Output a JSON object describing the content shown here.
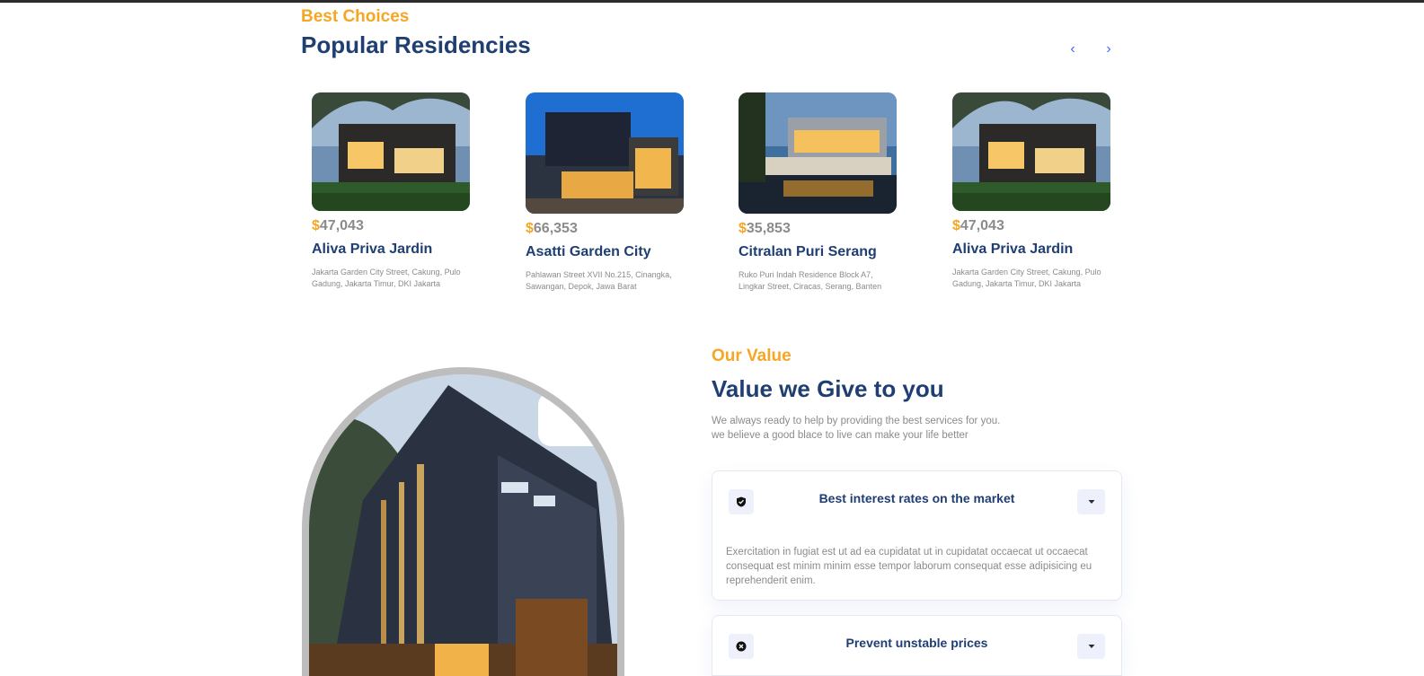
{
  "residencies": {
    "eyebrow": "Best Choices",
    "title": "Popular Residencies",
    "nav": {
      "prev_icon": "chevron-left-icon",
      "next_icon": "chevron-right-icon",
      "prev_glyph": "‹",
      "next_glyph": "›"
    },
    "cards": [
      {
        "currency": "$",
        "price": "47,043",
        "name": "Aliva Priva Jardin",
        "address": "Jakarta Garden City Street, Cakung, Pulo Gadung, Jakarta Timur, DKI Jakarta"
      },
      {
        "currency": "$",
        "price": "66,353",
        "name": "Asatti Garden City",
        "address": "Pahlawan Street XVII No.215, Cinangka, Sawangan, Depok, Jawa Barat"
      },
      {
        "currency": "$",
        "price": "35,853",
        "name": "Citralan Puri Serang",
        "address": "Ruko Puri Indah Residence Block A7, Lingkar Street, Ciracas, Serang, Banten"
      },
      {
        "currency": "$",
        "price": "47,043",
        "name": "Aliva Priva Jardin",
        "address": "Jakarta Garden City Street, Cakung, Pulo Gadung, Jakarta Timur, DKI Jakarta"
      }
    ]
  },
  "value": {
    "eyebrow": "Our Value",
    "title": "Value we Give to you",
    "desc_line1": "We always ready to help by providing the best services for you.",
    "desc_line2": "we believe a good blace to live can make your life better",
    "accordion": [
      {
        "icon": "shield-check-icon",
        "title": "Best interest rates on the market",
        "expanded": true,
        "body": "Exercitation in fugiat est ut ad ea cupidatat ut in cupidatat occaecat ut occaecat consequat est minim minim esse tempor laborum consequat esse adipisicing eu reprehenderit enim."
      },
      {
        "icon": "cancel-circle-icon",
        "title": "Prevent unstable prices",
        "expanded": false
      }
    ],
    "toggle_icon": "caret-down-icon"
  },
  "colors": {
    "accent": "#f5a623",
    "heading": "#1f3e72",
    "muted": "#8c8b8b",
    "link": "#4066ff",
    "icon_bg": "#eef0fb"
  }
}
